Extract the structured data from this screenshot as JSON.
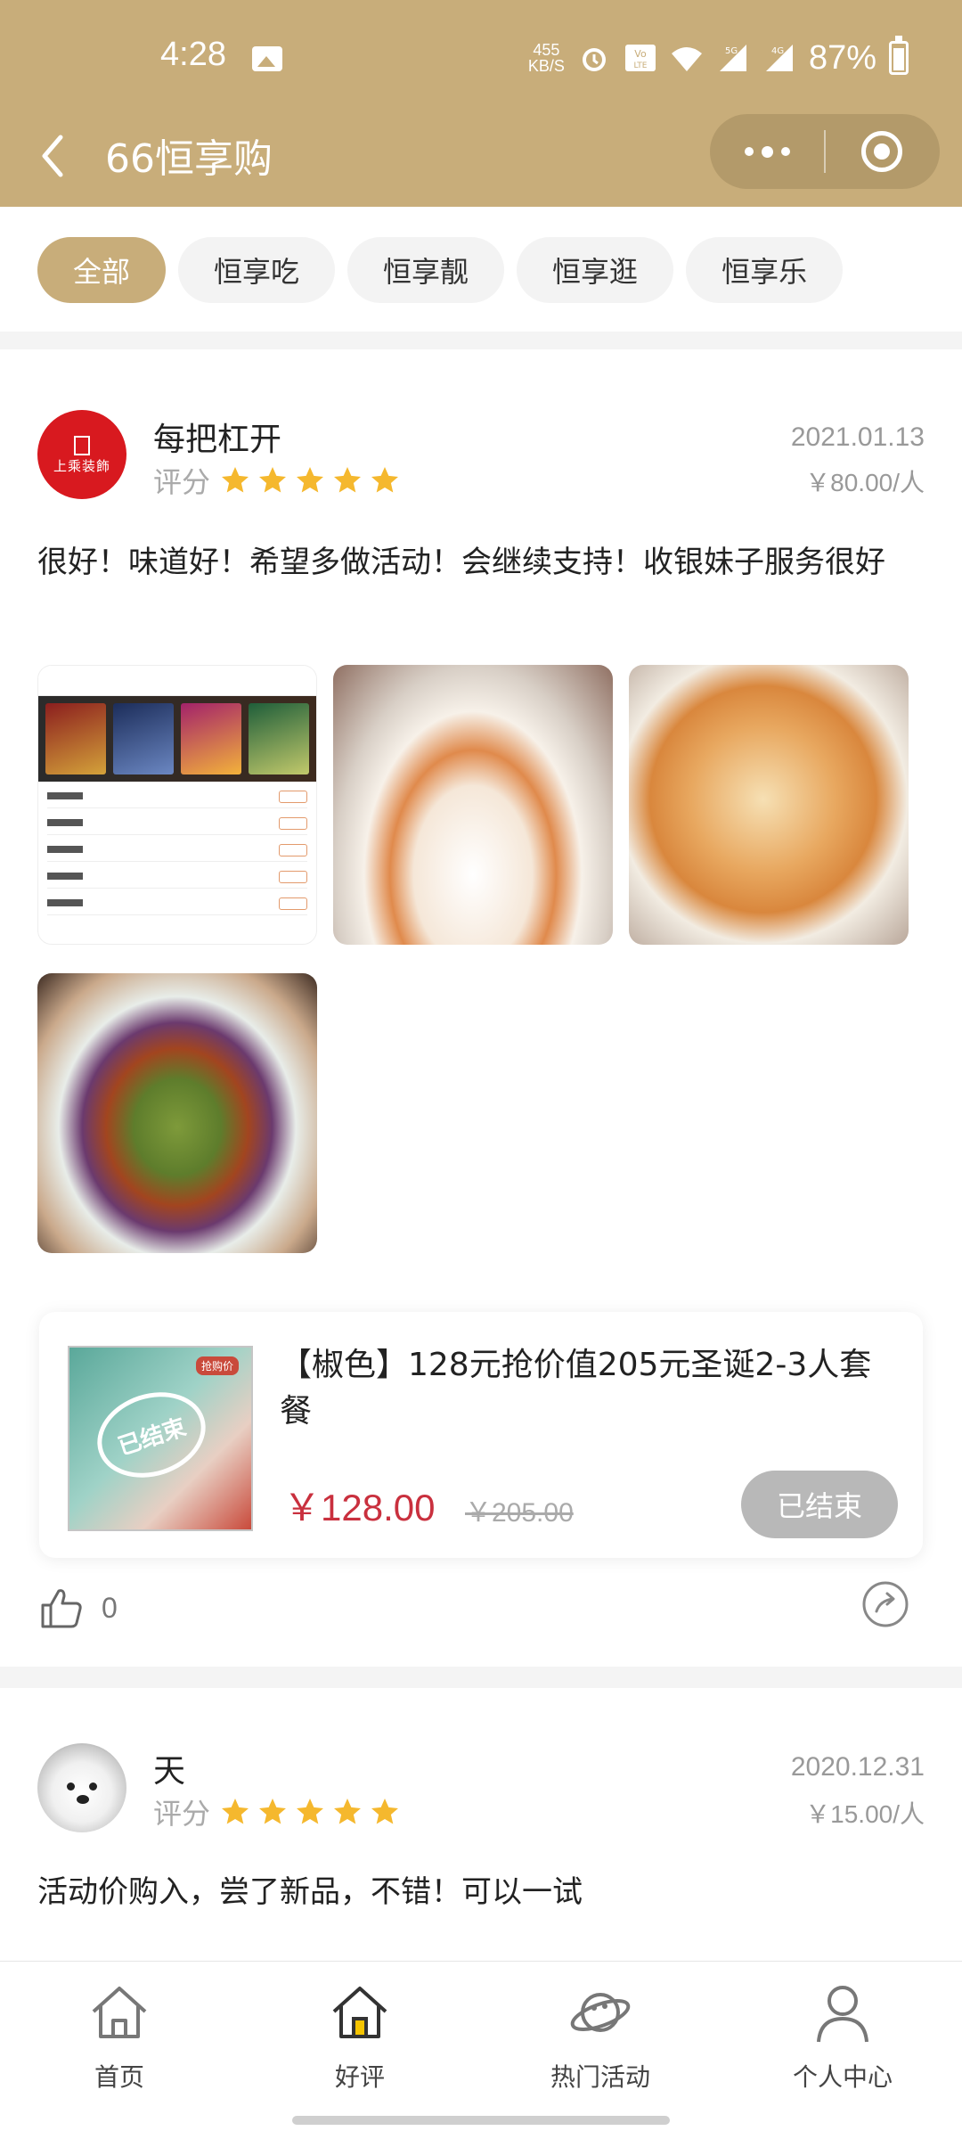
{
  "status_bar": {
    "time": "4:28",
    "net_speed": "455",
    "net_unit": "KB/S",
    "network_5g": "5G",
    "network_4g": "4G",
    "battery": "87%"
  },
  "header": {
    "title": "66恒享购",
    "accent_color": "#c8ad7a"
  },
  "tabs": [
    {
      "label": "全部",
      "active": true
    },
    {
      "label": "恒享吃",
      "active": false
    },
    {
      "label": "恒享靓",
      "active": false
    },
    {
      "label": "恒享逛",
      "active": false
    },
    {
      "label": "恒享乐",
      "active": false
    }
  ],
  "reviews": [
    {
      "avatar_text": "上乘装飾",
      "user": "每把杠开",
      "rating_label": "评分",
      "stars": 5,
      "date": "2021.01.13",
      "price_per": "￥80.00/人",
      "text": "很好！味道好！希望多做活动！会继续支持！收银妹子服务很好",
      "photos": [
        "movie-ticket-screenshot",
        "dessert-bowl",
        "fish-soup",
        "stir-fried-beans"
      ],
      "product": {
        "stamp": "已结束",
        "badge": "抢购价",
        "title": "【椒色】128元抢价值205元圣诞2-3人套餐",
        "price": "￥128.00",
        "original_price": "￥205.00",
        "status_button": "已结束"
      },
      "likes": "0"
    },
    {
      "user": "天",
      "rating_label": "评分",
      "stars": 5,
      "date": "2020.12.31",
      "price_per": "￥15.00/人",
      "text": "活动价购入，尝了新品，不错！可以一试"
    }
  ],
  "bottom_nav": [
    {
      "label": "首页",
      "icon": "home-icon"
    },
    {
      "label": "好评",
      "icon": "good-review-icon"
    },
    {
      "label": "热门活动",
      "icon": "planet-icon"
    },
    {
      "label": "个人中心",
      "icon": "user-icon"
    }
  ]
}
